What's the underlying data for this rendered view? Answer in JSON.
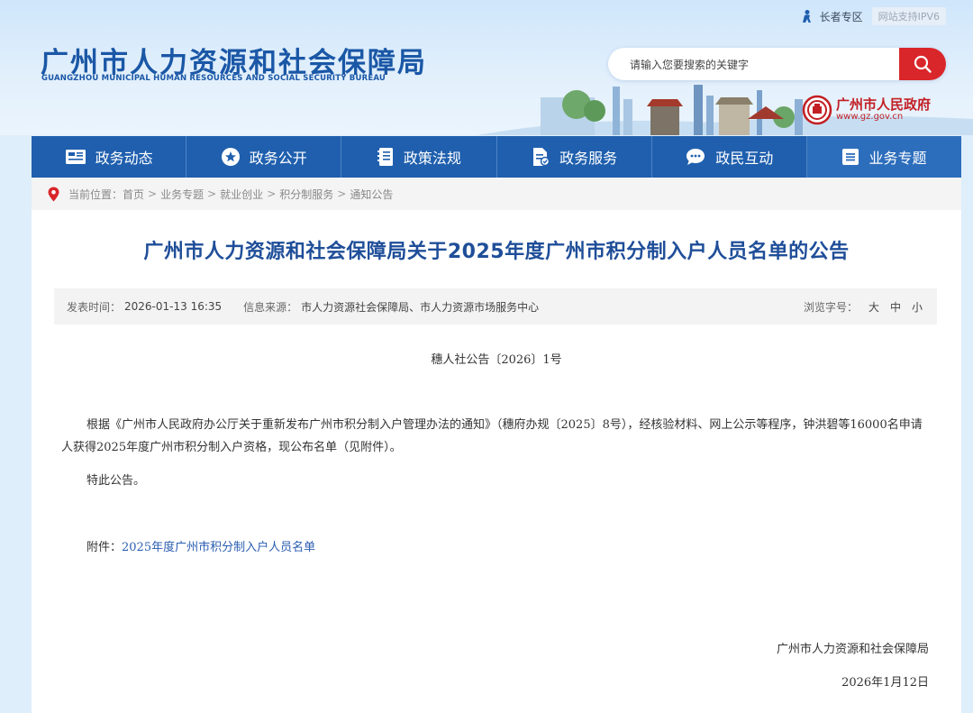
{
  "topbar": {
    "elder_label": "长者专区",
    "ipv6_label": "网站支持IPV6"
  },
  "site": {
    "title": "广州市人力资源和社会保障局",
    "subtitle": "GUANGZHOU MUNICIPAL HUMAN RESOURCES AND SOCIAL SECURITY BUREAU"
  },
  "search": {
    "placeholder": "请输入您要搜索的关键字"
  },
  "gov": {
    "name": "广州市人民政府",
    "url": "www.gz.gov.cn"
  },
  "nav": {
    "items": [
      {
        "label": "政务动态",
        "icon": "newspaper-icon"
      },
      {
        "label": "政务公开",
        "icon": "star-circle-icon"
      },
      {
        "label": "政策法规",
        "icon": "book-icon"
      },
      {
        "label": "政务服务",
        "icon": "document-icon"
      },
      {
        "label": "政民互动",
        "icon": "chat-icon"
      },
      {
        "label": "业务专题",
        "icon": "list-icon"
      }
    ]
  },
  "breadcrumb": {
    "label": "当前位置：",
    "items": [
      "首页",
      "业务专题",
      "就业创业",
      "积分制服务",
      "通知公告"
    ]
  },
  "article": {
    "title": "广州市人力资源和社会保障局关于2025年度广州市积分制入户人员名单的公告",
    "meta": {
      "date_label": "发表时间：",
      "date": "2026-01-13 16:35",
      "source_label": "信息来源：",
      "source": "市人力资源社会保障局、市人力资源市场服务中心",
      "font_label": "浏览字号：",
      "font_large": "大",
      "font_medium": "中",
      "font_small": "小"
    },
    "doc_number": "穗人社公告〔2026〕1号",
    "para1": "根据《广州市人民政府办公厅关于重新发布广州市积分制入户管理办法的通知》（穗府办规〔2025〕8号），经核验材料、网上公示等程序，钟洪碧等16000名申请人获得2025年度广州市积分制入户资格，现公布名单（见附件）。",
    "para2": "特此公告。",
    "attachment_label": "附件：",
    "attachment_link": "2025年度广州市积分制入户人员名单",
    "signature": "广州市人力资源和社会保障局",
    "sign_date": "2026年1月12日"
  },
  "colors": {
    "brand_blue": "#1f5fae",
    "title_blue": "#1f4e99",
    "accent_red": "#d9262a"
  }
}
